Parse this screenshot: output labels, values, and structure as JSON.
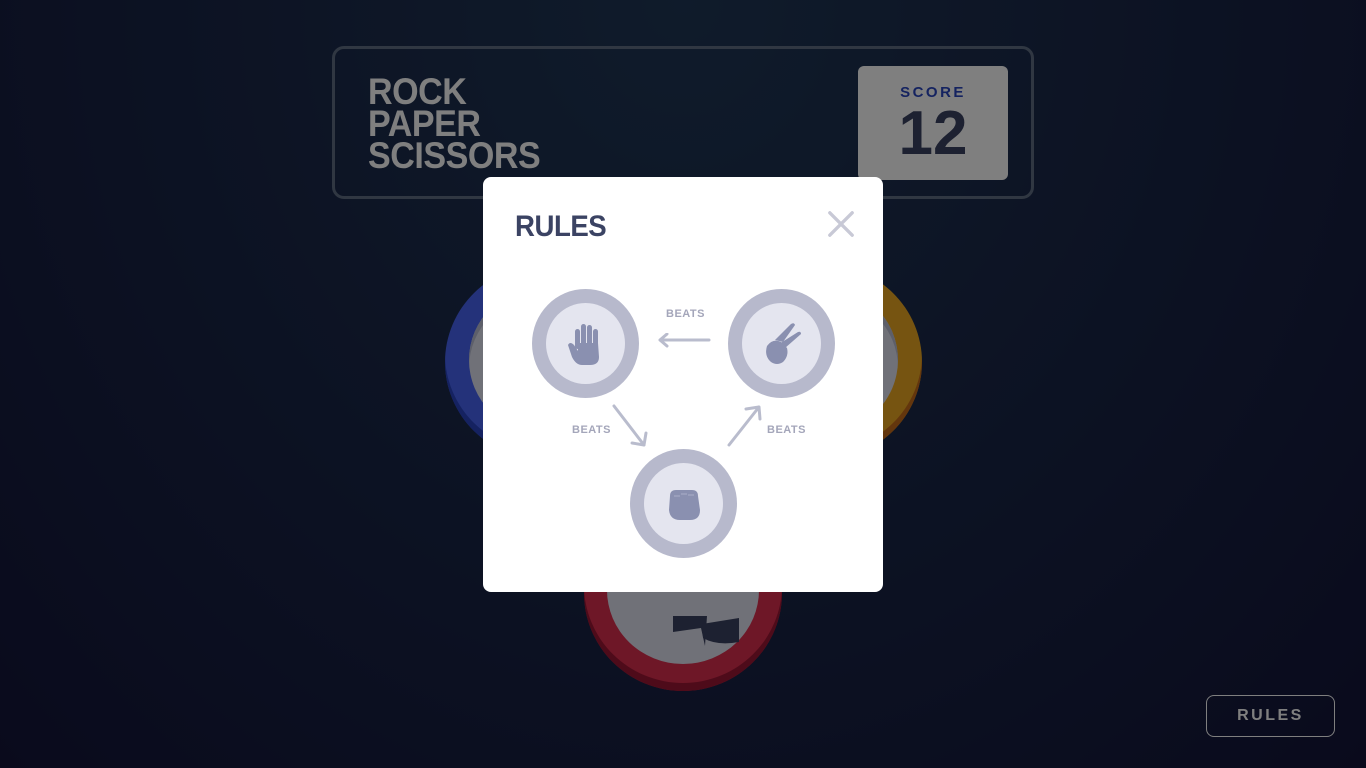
{
  "header": {
    "title_lines": [
      "ROCK",
      "PAPER",
      "SCISSORS"
    ],
    "score_label": "SCORE",
    "score_value": "12"
  },
  "rules_button_label": "RULES",
  "modal": {
    "title": "RULES",
    "beats_label_top": "BEATS",
    "beats_label_left": "BEATS",
    "beats_label_right": "BEATS",
    "icons": {
      "close": "close-icon",
      "paper": "paper-hand-icon",
      "scissors": "scissors-hand-icon",
      "rock": "rock-fist-icon"
    }
  },
  "colors": {
    "paper": "#4865f4",
    "scissors": "#eca922",
    "rock": "#dc2e4e",
    "dark_text": "#3b4363",
    "score_text": "#2a46c0"
  }
}
